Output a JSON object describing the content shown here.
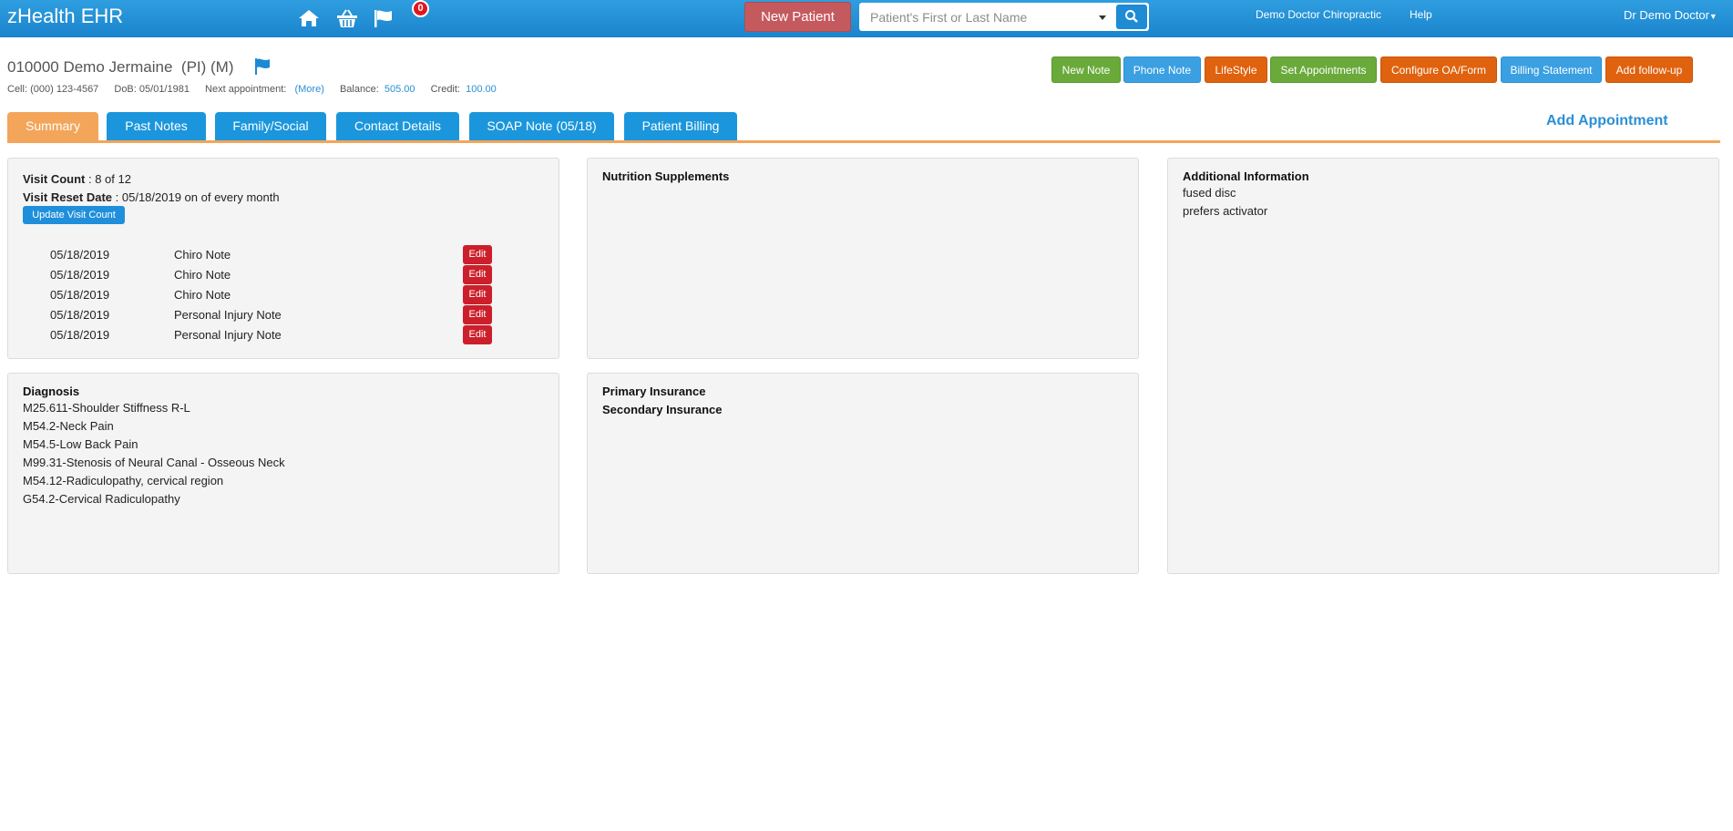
{
  "app": {
    "title": "zHealth EHR",
    "notification_count": "0",
    "new_patient_label": "New Patient",
    "search_placeholder": "Patient's First or Last Name",
    "links": [
      "Demo Doctor Chiropractic",
      "Help"
    ],
    "user_menu": "Dr Demo Doctor",
    "colors": {
      "navbar": "#1a84cc",
      "accent": "#f3a55a",
      "danger": "#cc1f2b"
    }
  },
  "patient": {
    "name": "010000 Demo Jermaine",
    "tags": "(PI) (M)",
    "cell_label": "Cell:",
    "cell": "(000) 123-4567",
    "dob_label": "DoB:",
    "dob": "05/01/1981",
    "next_appt_label": "Next appointment:",
    "next_appt": "(More)",
    "balance_label": "Balance:",
    "balance": "505.00",
    "credit_label": "Credit:",
    "credit": "100.00"
  },
  "actions": [
    "New Note",
    "Phone Note",
    "LifeStyle",
    "Set Appointments",
    "Configure OA/Form",
    "Billing Statement",
    "Add follow-up"
  ],
  "tabs": [
    "Summary",
    "Past Notes",
    "Family/Social",
    "Contact Details",
    "SOAP Note (05/18)",
    "Patient Billing"
  ],
  "active_tab": "Summary",
  "add_appointment": "Add Appointment",
  "visits": {
    "count_label": "Visit Count",
    "count": " : 8 of 12",
    "reset_label": "Visit Reset Date",
    "reset": " : 05/18/2019 on of every month",
    "update_label": "Update Visit Count",
    "edit_label": "Edit",
    "notes": [
      {
        "date": "05/18/2019",
        "type": "Chiro Note"
      },
      {
        "date": "05/18/2019",
        "type": "Chiro Note"
      },
      {
        "date": "05/18/2019",
        "type": "Chiro Note"
      },
      {
        "date": "05/18/2019",
        "type": "Personal Injury Note"
      },
      {
        "date": "05/18/2019",
        "type": "Personal Injury Note"
      }
    ]
  },
  "nutrition": {
    "title": "Nutrition Supplements"
  },
  "additional": {
    "title": "Additional Information",
    "items": [
      "fused disc",
      "prefers activator"
    ]
  },
  "diagnosis": {
    "title": "Diagnosis",
    "items": [
      "M25.611-Shoulder Stiffness R-L",
      "M54.2-Neck Pain",
      "M54.5-Low Back Pain",
      "M99.31-Stenosis of Neural Canal - Osseous Neck",
      "M54.12-Radiculopathy, cervical region",
      "G54.2-Cervical Radiculopathy"
    ]
  },
  "insurance": {
    "primary": "Primary Insurance",
    "secondary": "Secondary Insurance"
  }
}
